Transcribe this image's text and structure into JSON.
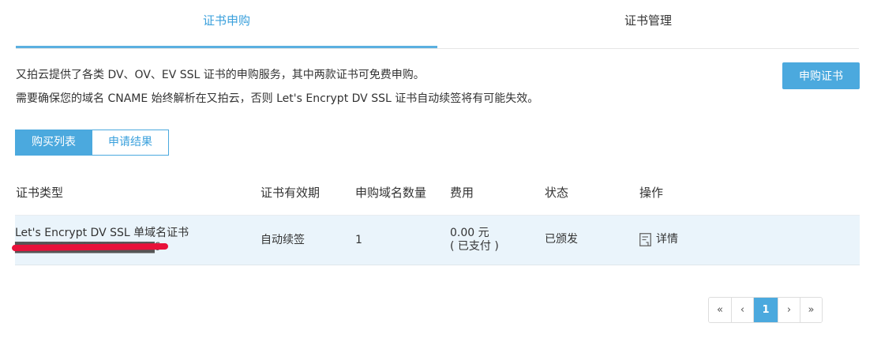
{
  "tabs": [
    {
      "label": "证书申购",
      "active": true
    },
    {
      "label": "证书管理",
      "active": false
    }
  ],
  "intro": {
    "line1": "又拍云提供了各类 DV、OV、EV SSL 证书的申购服务，其中两款证书可免费申购。",
    "line2": "需要确保您的域名 CNAME 始终解析在又拍云，否则 Let's Encrypt DV SSL 证书自动续签将有可能失效。"
  },
  "buy_button": "申购证书",
  "segments": [
    {
      "label": "购买列表",
      "active": true
    },
    {
      "label": "申请结果",
      "active": false
    }
  ],
  "table": {
    "headers": [
      "证书类型",
      "证书有效期",
      "申购域名数量",
      "费用",
      "状态",
      "操作"
    ],
    "rows": [
      {
        "type": "Let's Encrypt DV SSL 单域名证书",
        "order_no": "▇▇▇▇▇▇▇▇▇▇▇▇▇▇▇▇▇▇6",
        "validity": "自动续签",
        "count": "1",
        "fee": "0.00 元",
        "fee_note": "( 已支付 )",
        "status": "已颁发",
        "action": "详情"
      }
    ]
  },
  "pagination": {
    "first": "«",
    "prev": "‹",
    "current": "1",
    "next": "›",
    "last": "»"
  },
  "colors": {
    "accent": "#4ba9de",
    "row_highlight": "#eaf4fb",
    "redaction": "#e8113a"
  }
}
